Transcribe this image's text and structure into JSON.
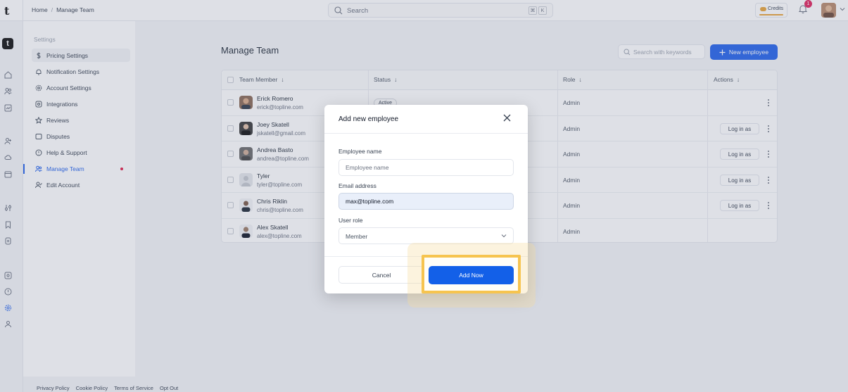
{
  "topbar": {
    "logo": "t",
    "breadcrumb": [
      "Home",
      "Manage Team"
    ],
    "breadcrumb_sep": "/",
    "search_placeholder": "Search",
    "shortcut": [
      "⌘",
      "K"
    ],
    "credits_label": "Credits",
    "notifications_count": "1"
  },
  "rail": {
    "logo": "t",
    "icons": [
      "home-icon",
      "team-icon",
      "analytics-icon",
      "add-user-icon",
      "cloud-icon",
      "calendar-icon",
      "sliders-icon",
      "bookmark-icon",
      "billing-icon",
      "integrations-icon",
      "support-icon",
      "settings-icon",
      "users-icon"
    ]
  },
  "settings": {
    "title": "Settings",
    "items": [
      {
        "label": "Pricing Settings",
        "icon": "dollar-icon"
      },
      {
        "label": "Notification Settings",
        "icon": "bell-icon"
      },
      {
        "label": "Account Settings",
        "icon": "gear-icon"
      },
      {
        "label": "Integrations",
        "icon": "integrations-icon"
      },
      {
        "label": "Reviews",
        "icon": "star-icon"
      },
      {
        "label": "Disputes",
        "icon": "dispute-icon"
      },
      {
        "label": "Help & Support",
        "icon": "help-icon"
      },
      {
        "label": "Manage Team",
        "icon": "team-icon"
      },
      {
        "label": "Edit Account",
        "icon": "edit-user-icon"
      }
    ]
  },
  "main": {
    "title": "Manage Team",
    "keyword_search_placeholder": "Search with keywords",
    "new_employee_label": "New employee",
    "columns": [
      "Team Member",
      "Status",
      "Role",
      "Actions"
    ],
    "rows": [
      {
        "name": "Erick Romero",
        "email": "erick@topline.com",
        "status": "Active",
        "role": "Admin",
        "action": ""
      },
      {
        "name": "Joey Skatell",
        "email": "jskatell@gmail.com",
        "status": "",
        "role": "Admin",
        "action": "Log in as"
      },
      {
        "name": "Andrea Basto",
        "email": "andrea@topline.com",
        "status": "",
        "role": "Admin",
        "action": "Log in as"
      },
      {
        "name": "Tyler",
        "email": "tyler@topline.com",
        "status": "",
        "role": "Admin",
        "action": "Log in as"
      },
      {
        "name": "Chris Riklin",
        "email": "chris@topline.com",
        "status": "",
        "role": "Admin",
        "action": "Log in as"
      },
      {
        "name": "Alex Skatell",
        "email": "alex@topline.com",
        "status": "",
        "role": "Admin",
        "action": ""
      }
    ]
  },
  "footer": {
    "links": [
      "Privacy Policy",
      "Cookie Policy",
      "Terms of Service",
      "Opt Out"
    ]
  },
  "modal": {
    "title": "Add new employee",
    "name_label": "Employee name",
    "name_placeholder": "Employee name",
    "email_label": "Email address",
    "email_value": "max@topline.com",
    "role_label": "User role",
    "role_value": "Member",
    "cancel_label": "Cancel",
    "submit_label": "Add Now"
  },
  "colors": {
    "accent": "#2563eb",
    "highlight": "#f6c44f",
    "badge": "#e0245e"
  }
}
